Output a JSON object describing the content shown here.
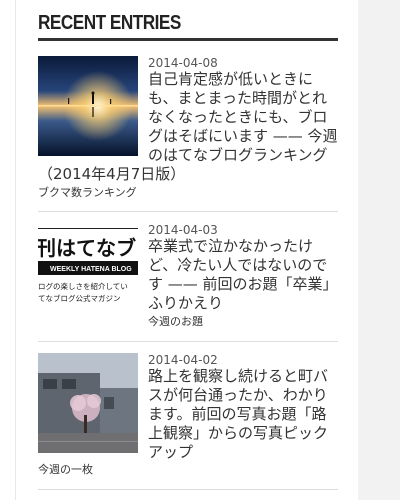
{
  "sidebar": {
    "module_title": "RECENT ENTRIES",
    "entries": [
      {
        "date": "2014-04-08",
        "title": "自己肯定感が低いときにも、まとまった時間がとれなくなったときにも、ブログはそばにいます —— 今週のはてなブログランキング（2014年4月7日版）",
        "category": "ブクマ数ランキング"
      },
      {
        "date": "2014-04-03",
        "title": "卒業式で泣かなかったけど、冷たい人ではないのです —— 前回のお題「卒業」ふりかえり",
        "category": "今週のお題",
        "thumbnail": {
          "line1": "刊はてなブ",
          "line2": "WEEKLY HATENA BLOG",
          "line3": "ログの楽しさを紹介してい",
          "line4": "てなブログ公式マガジン"
        }
      },
      {
        "date": "2014-04-02",
        "title": "路上を観察し続けると町バスが何台通ったか、わかります。前回の写真お題「路上観察」からの写真ピックアップ",
        "category": "今週の一枚"
      }
    ]
  }
}
